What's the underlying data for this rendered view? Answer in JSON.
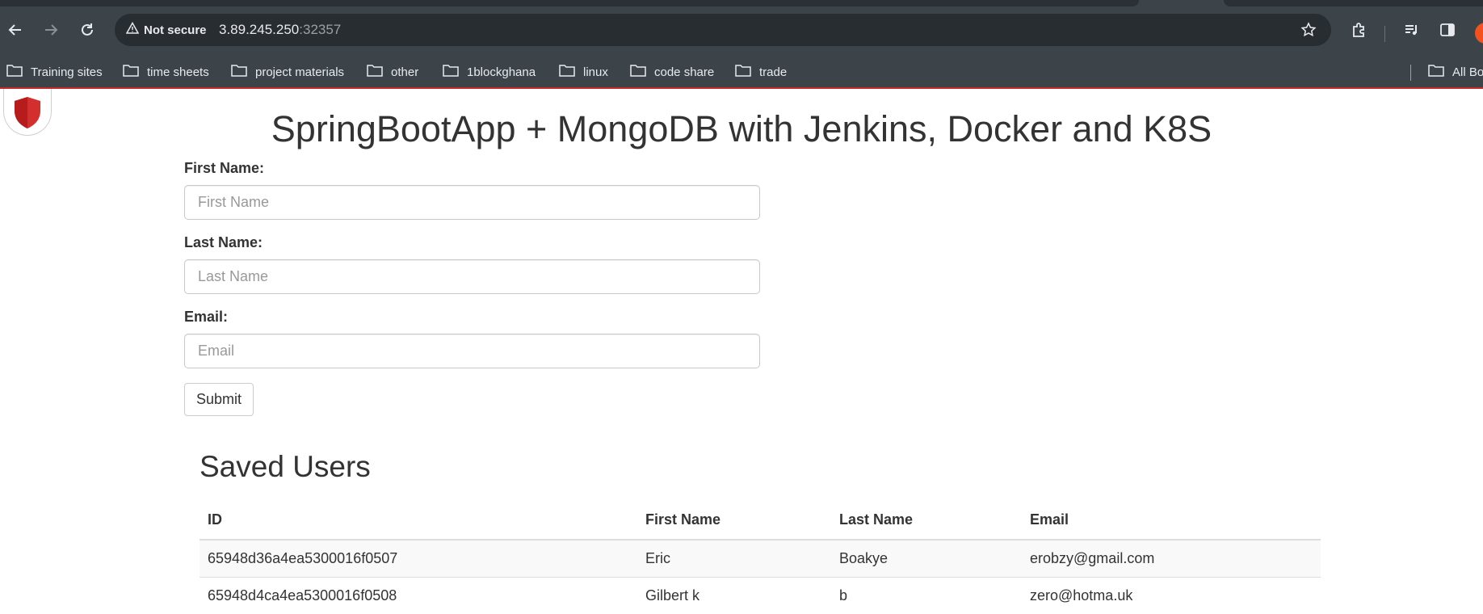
{
  "browser": {
    "security_label": "Not secure",
    "url_host": "3.89.245.250",
    "url_port": ":32357",
    "bookmarks": [
      "Training sites",
      "time sheets",
      "project materials",
      "other",
      "1blockghana",
      "linux",
      "code share",
      "trade"
    ],
    "all_bookmarks_label": "All Bo"
  },
  "page": {
    "title": "SpringBootApp + MongoDB with Jenkins, Docker and K8S",
    "form": {
      "first_name_label": "First Name:",
      "first_name_placeholder": "First Name",
      "last_name_label": "Last Name:",
      "last_name_placeholder": "Last Name",
      "email_label": "Email:",
      "email_placeholder": "Email",
      "submit_label": "Submit"
    },
    "users_heading": "Saved Users",
    "table": {
      "headers": [
        "ID",
        "First Name",
        "Last Name",
        "Email"
      ],
      "rows": [
        [
          "65948d36a4ea5300016f0507",
          "Eric",
          "Boakye",
          "erobzy@gmail.com"
        ],
        [
          "65948d4ca4ea5300016f0508",
          "Gilbert k",
          "b",
          "zero@hotma.uk"
        ]
      ]
    }
  },
  "colors": {
    "chrome_bg": "#3c4449",
    "omnibox_bg": "#272d31",
    "accent_red": "#c62828",
    "logo_red": "#d32f2f"
  },
  "icons": [
    "back-icon",
    "forward-icon",
    "reload-icon",
    "warning-icon",
    "star-icon",
    "extensions-icon",
    "media-icon",
    "side-panel-icon",
    "folder-icon",
    "shield-logo-icon"
  ]
}
